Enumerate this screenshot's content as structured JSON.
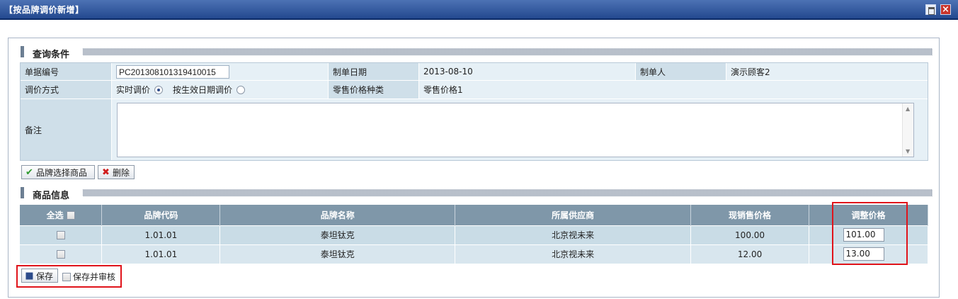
{
  "window": {
    "title": "【按品牌调价新增】"
  },
  "query_section": {
    "title": "查询条件"
  },
  "form": {
    "doc_no_label": "单据编号",
    "doc_no_value": "PC201308101319410015",
    "date_label": "制单日期",
    "date_value": "2013-08-10",
    "creator_label": "制单人",
    "creator_value": "演示顾客2",
    "method_label": "调价方式",
    "method_option_realtime": "实时调价",
    "method_option_effective": "按生效日期调价",
    "method_selected": "实时调价",
    "price_type_label": "零售价格种类",
    "price_type_value": "零售价格1",
    "remark_label": "备注",
    "remark_value": ""
  },
  "toolbar": {
    "select_brand_label": "品牌选择商品",
    "delete_label": "删除"
  },
  "goods_section": {
    "title": "商品信息"
  },
  "grid": {
    "select_all_label": "全选",
    "columns": [
      "品牌代码",
      "品牌名称",
      "所属供应商",
      "现销售价格",
      "调整价格"
    ],
    "rows": [
      {
        "code": "1.01.01",
        "name": "泰坦钛克",
        "supplier": "北京视未来",
        "current_price": "100.00",
        "adjusted_price": "101.00"
      },
      {
        "code": "1.01.01",
        "name": "泰坦钛克",
        "supplier": "北京视未来",
        "current_price": "12.00",
        "adjusted_price": "13.00"
      }
    ]
  },
  "footer": {
    "save_label": "保存",
    "save_audit_label": "保存并审核"
  },
  "colors": {
    "title_bar": "#23498f",
    "grid_header": "#7f97a9",
    "highlight": "#e0141b"
  }
}
